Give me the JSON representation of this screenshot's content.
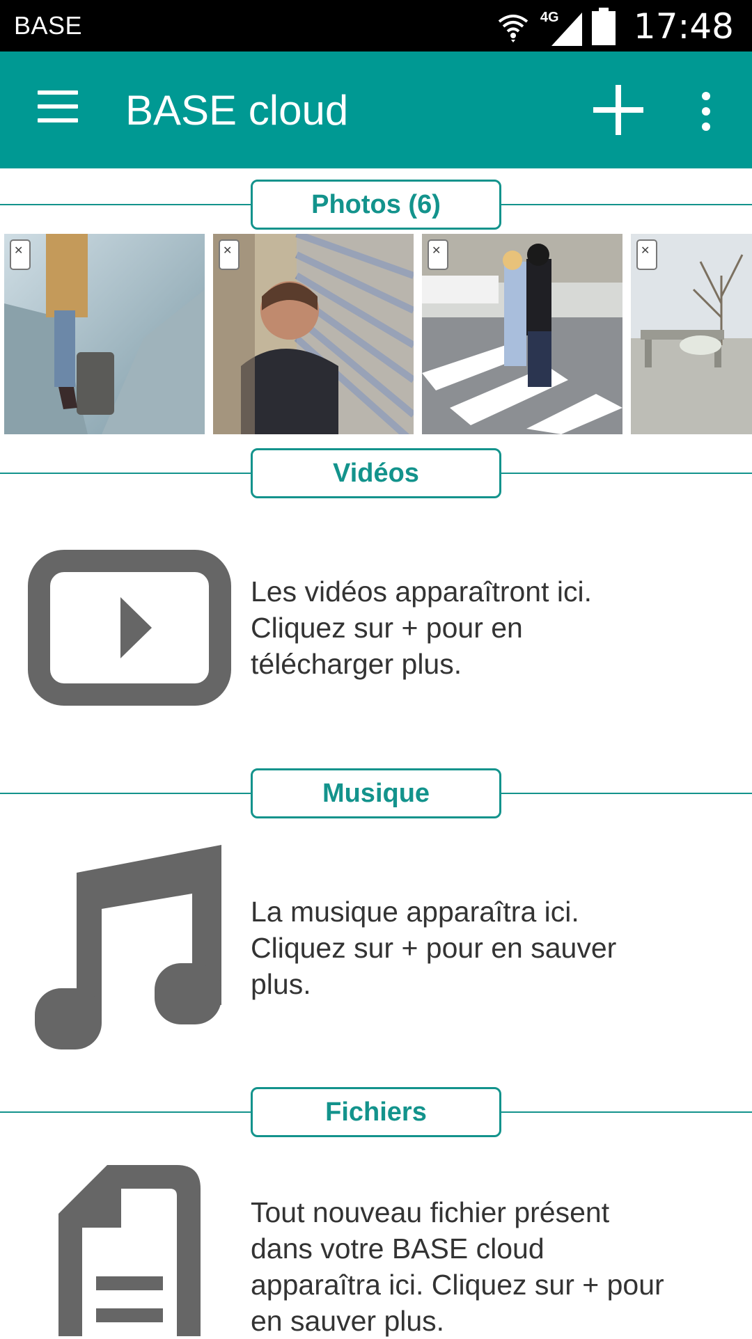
{
  "status_bar": {
    "carrier": "BASE",
    "network": "4G",
    "time": "17:48"
  },
  "app_bar": {
    "title": "BASE cloud",
    "menu_icon": "hamburger-menu-icon",
    "add_icon": "plus-icon",
    "more_icon": "more-vertical-icon"
  },
  "sections": {
    "photos": {
      "label": "Photos (6)"
    },
    "videos": {
      "label": "Vidéos",
      "empty_line1": "Les vidéos apparaîtront ici.",
      "empty_line2": "Cliquez sur + pour en",
      "empty_line3": "télécharger plus.",
      "icon": "video-play-icon"
    },
    "music": {
      "label": "Musique",
      "empty_line1": "La musique apparaîtra ici.",
      "empty_line2": "Cliquez sur + pour en sauver",
      "empty_line3": "plus.",
      "icon": "music-note-icon"
    },
    "files": {
      "label": "Fichiers",
      "empty_line1": "Tout nouveau fichier présent",
      "empty_line2": "dans votre BASE cloud",
      "empty_line3": "apparaîtra ici. Cliquez sur + pour",
      "empty_line4": "en sauver plus.",
      "icon": "document-icon"
    }
  },
  "colors": {
    "accent": "#009993",
    "accent_line": "#13938c",
    "icon_gray": "#666666",
    "text": "#333333"
  }
}
